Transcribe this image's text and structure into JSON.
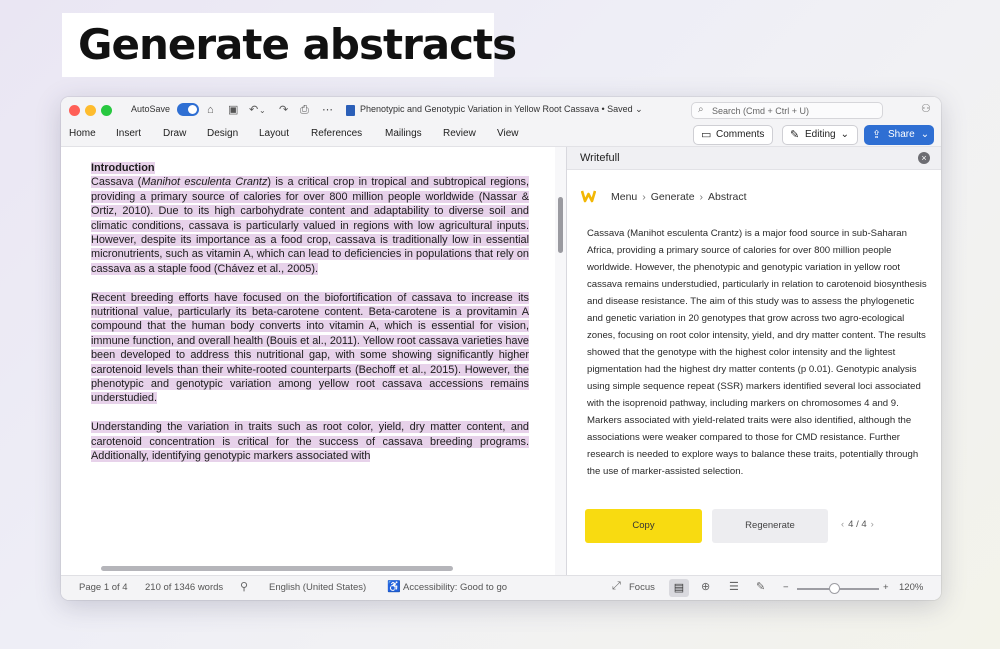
{
  "headline": "Generate abstracts",
  "titlebar": {
    "autosave_label": "AutoSave",
    "document_title": "Phenotypic and Genotypic Variation in Yellow Root Cassava",
    "save_state": "• Saved ⌄",
    "search_placeholder": "Search (Cmd + Ctrl + U)"
  },
  "ribbon": {
    "tabs": [
      "Home",
      "Insert",
      "Draw",
      "Design",
      "Layout",
      "References",
      "Mailings",
      "Review",
      "View"
    ],
    "comments_label": "Comments",
    "editing_label": "Editing",
    "share_label": "Share"
  },
  "document": {
    "heading": "Introduction",
    "p1_before_italic": "Cassava (",
    "p1_italic": "Manihot esculenta Crantz",
    "p1_after_italic": ") is a critical crop in tropical and subtropical regions, providing a primary source of calories for over 800 million people worldwide (Nassar & Ortiz, 2010). Due to its high carbohydrate content and adaptability to diverse soil and climatic conditions, cassava is particularly valued in regions with low agricultural inputs. However, despite its importance as a food crop, cassava is traditionally low in essential micronutrients, such as vitamin A, which can lead to deficiencies in populations that rely on cassava as a staple food (Chávez et al., 2005).",
    "p2": "Recent breeding efforts have focused on the biofortification of cassava to increase its nutritional value, particularly its beta-carotene content. Beta-carotene is a provitamin A compound that the human body converts into vitamin A, which is essential for vision, immune function, and overall health (Bouis et al., 2011). Yellow root cassava varieties have been developed to address this nutritional gap, with some showing significantly higher carotenoid levels than their white-rooted counterparts (Bechoff et al., 2015). However, the phenotypic and genotypic variation among yellow root cassava accessions remains understudied.",
    "p3": "Understanding the variation in traits such as root color, yield, dry matter content, and carotenoid concentration is critical for the success of cassava breeding programs. Additionally, identifying genotypic markers associated with"
  },
  "panel": {
    "title": "Writefull",
    "breadcrumb": [
      "Menu",
      "Generate",
      "Abstract"
    ],
    "breadcrumb_sep": "›",
    "abstract": "Cassava (Manihot esculenta Crantz) is a major food source in sub-Saharan Africa, providing a primary source of calories for over 800 million people worldwide. However, the phenotypic and genotypic variation in yellow root cassava remains understudied, particularly in relation to carotenoid biosynthesis and disease resistance. The aim of this study was to assess the phylogenetic and genetic variation in 20 genotypes that grow across two agro-ecological zones, focusing on root color intensity, yield, and dry matter content. The results showed that the genotype with the highest color intensity and the lightest pigmentation had the highest dry matter contents (p 0.01). Genotypic analysis using simple sequence repeat (SSR) markers identified several loci associated with the isoprenoid pathway, including markers on chromosomes 4 and 9. Markers associated with yield-related traits were also identified, although the associations were weaker compared to those for CMD resistance. Further research is needed to explore ways to balance these traits, potentially through the use of marker-assisted selection.",
    "copy_label": "Copy",
    "regenerate_label": "Regenerate",
    "pager": "4 / 4"
  },
  "statusbar": {
    "page": "Page 1 of 4",
    "words": "210 of 1346 words",
    "language": "English (United States)",
    "accessibility": "Accessibility: Good to go",
    "focus": "Focus",
    "zoom_minus": "−",
    "zoom_plus": "+",
    "zoom": "120%"
  },
  "colors": {
    "accent_blue": "#2f6fd3",
    "highlight": "#e7d2ea",
    "copy_yellow": "#f8db11"
  }
}
